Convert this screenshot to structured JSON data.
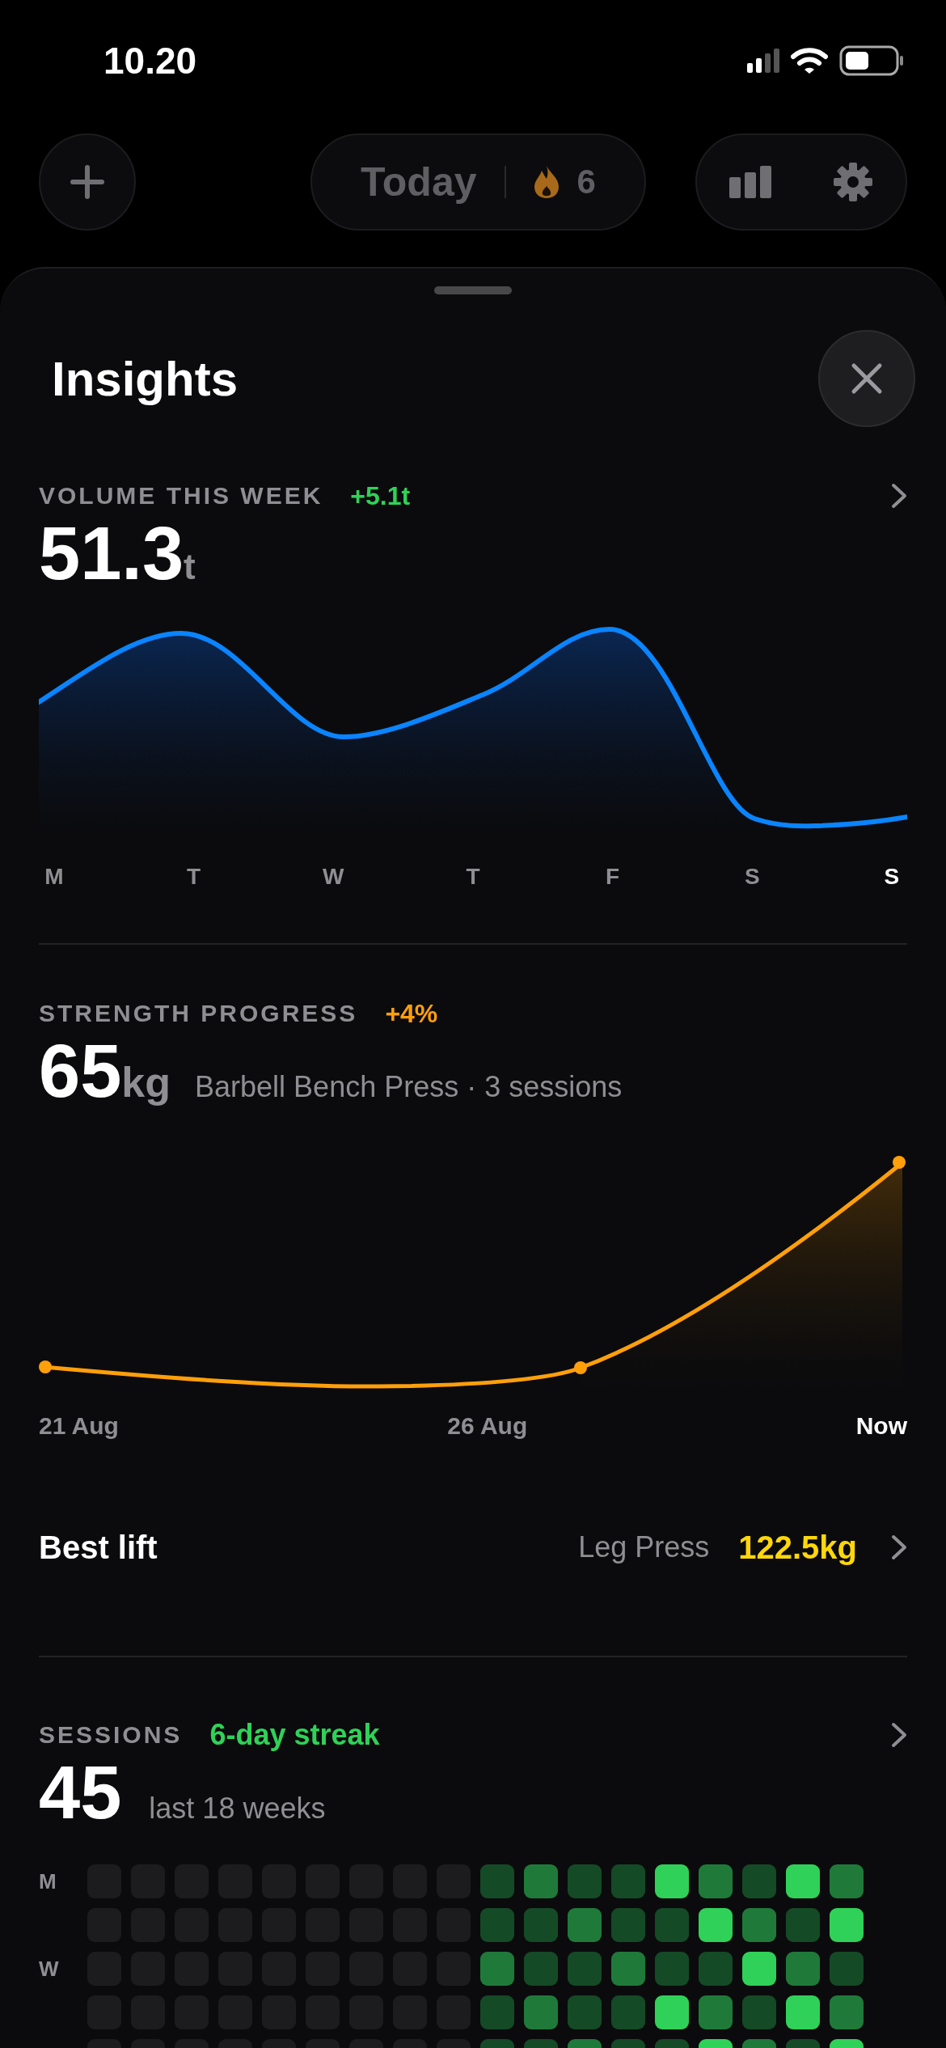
{
  "status_bar": {
    "time": "10.20"
  },
  "top_bar": {
    "today": "Today",
    "streak": "6"
  },
  "sheet": {
    "title": "Insights"
  },
  "volume": {
    "label": "VOLUME THIS WEEK",
    "change": "+5.1t",
    "value": "51.3",
    "unit": "t",
    "days": [
      {
        "label": "M",
        "current": false
      },
      {
        "label": "T",
        "current": false
      },
      {
        "label": "W",
        "current": false
      },
      {
        "label": "T",
        "current": false
      },
      {
        "label": "F",
        "current": false
      },
      {
        "label": "S",
        "current": false
      },
      {
        "label": "S",
        "current": true
      }
    ]
  },
  "strength": {
    "label": "STRENGTH PROGRESS",
    "change": "+4%",
    "value": "65",
    "unit": "kg",
    "detail": "Barbell Bench Press · 3 sessions",
    "dates": [
      {
        "label": "21 Aug",
        "current": false
      },
      {
        "label": "26 Aug",
        "current": false
      },
      {
        "label": "Now",
        "current": true
      }
    ]
  },
  "best_lift": {
    "label": "Best lift",
    "exercise": "Leg Press",
    "weight": "122.5kg"
  },
  "sessions": {
    "label": "SESSIONS",
    "streak": "6-day streak",
    "value": "45",
    "period": "last 18 weeks",
    "rows": [
      {
        "label": "M",
        "cells": [
          {
            "color": "#1c1c1e"
          },
          {
            "color": "#1c1c1e"
          },
          {
            "color": "#1c1c1e"
          },
          {
            "color": "#1c1c1e"
          },
          {
            "color": "#1c1c1e"
          },
          {
            "color": "#1c1c1e"
          },
          {
            "color": "#1c1c1e"
          },
          {
            "color": "#1c1c1e"
          },
          {
            "color": "#1c1c1e"
          },
          {
            "color": "#154a26"
          },
          {
            "color": "#1f7a3a"
          },
          {
            "color": "#154a26"
          },
          {
            "color": "#154a26"
          },
          {
            "color": "#30d158"
          },
          {
            "color": "#1f7a3a"
          },
          {
            "color": "#154a26"
          },
          {
            "color": "#30d158"
          },
          {
            "color": "#1f7a3a"
          }
        ]
      },
      {
        "cells": [
          {
            "color": "#1c1c1e"
          },
          {
            "color": "#1c1c1e"
          },
          {
            "color": "#1c1c1e"
          },
          {
            "color": "#1c1c1e"
          },
          {
            "color": "#1c1c1e"
          },
          {
            "color": "#1c1c1e"
          },
          {
            "color": "#1c1c1e"
          },
          {
            "color": "#1c1c1e"
          },
          {
            "color": "#1c1c1e"
          },
          {
            "color": "#154a26"
          },
          {
            "color": "#154a26"
          },
          {
            "color": "#1f7a3a"
          },
          {
            "color": "#154a26"
          },
          {
            "color": "#154a26"
          },
          {
            "color": "#30d158"
          },
          {
            "color": "#1f7a3a"
          },
          {
            "color": "#154a26"
          },
          {
            "color": "#30d158"
          }
        ]
      },
      {
        "label": "W",
        "cells": [
          {
            "color": "#1c1c1e"
          },
          {
            "color": "#1c1c1e"
          },
          {
            "color": "#1c1c1e"
          },
          {
            "color": "#1c1c1e"
          },
          {
            "color": "#1c1c1e"
          },
          {
            "color": "#1c1c1e"
          },
          {
            "color": "#1c1c1e"
          },
          {
            "color": "#1c1c1e"
          },
          {
            "color": "#1c1c1e"
          },
          {
            "color": "#1f7a3a"
          },
          {
            "color": "#154a26"
          },
          {
            "color": "#154a26"
          },
          {
            "color": "#1f7a3a"
          },
          {
            "color": "#154a26"
          },
          {
            "color": "#154a26"
          },
          {
            "color": "#30d158"
          },
          {
            "color": "#1f7a3a"
          },
          {
            "color": "#154a26"
          }
        ]
      },
      {
        "cells": [
          {
            "color": "#1c1c1e"
          },
          {
            "color": "#1c1c1e"
          },
          {
            "color": "#1c1c1e"
          },
          {
            "color": "#1c1c1e"
          },
          {
            "color": "#1c1c1e"
          },
          {
            "color": "#1c1c1e"
          },
          {
            "color": "#1c1c1e"
          },
          {
            "color": "#1c1c1e"
          },
          {
            "color": "#1c1c1e"
          },
          {
            "color": "#154a26"
          },
          {
            "color": "#1f7a3a"
          },
          {
            "color": "#154a26"
          },
          {
            "color": "#154a26"
          },
          {
            "color": "#30d158"
          },
          {
            "color": "#1f7a3a"
          },
          {
            "color": "#154a26"
          },
          {
            "color": "#30d158"
          },
          {
            "color": "#1f7a3a"
          }
        ]
      },
      {
        "cells": [
          {
            "color": "#1c1c1e"
          },
          {
            "color": "#1c1c1e"
          },
          {
            "color": "#1c1c1e"
          },
          {
            "color": "#1c1c1e"
          },
          {
            "color": "#1c1c1e"
          },
          {
            "color": "#1c1c1e"
          },
          {
            "color": "#1c1c1e"
          },
          {
            "color": "#1c1c1e"
          },
          {
            "color": "#1c1c1e"
          },
          {
            "color": "#154a26"
          },
          {
            "color": "#154a26"
          },
          {
            "color": "#1f7a3a"
          },
          {
            "color": "#154a26"
          },
          {
            "color": "#154a26"
          },
          {
            "color": "#30d158"
          },
          {
            "color": "#1f7a3a"
          },
          {
            "color": "#154a26"
          },
          {
            "color": "#30d158"
          }
        ]
      }
    ]
  }
}
